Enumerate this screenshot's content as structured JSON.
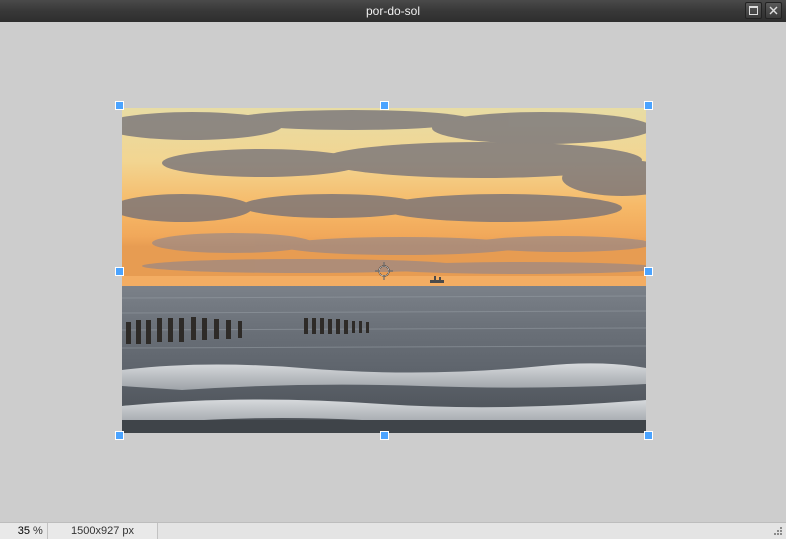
{
  "window": {
    "title": "por-do-sol"
  },
  "status": {
    "zoom_value": "35",
    "zoom_unit": "%",
    "dimensions": "1500x927 px"
  },
  "icons": {
    "maximize": "maximize-icon",
    "close": "close-icon",
    "resize_grip": "resize-grip-icon"
  },
  "colors": {
    "handle": "#4aa3ff",
    "workspace_bg": "#cdcdcd",
    "titlebar_text": "#f0f0f0"
  }
}
